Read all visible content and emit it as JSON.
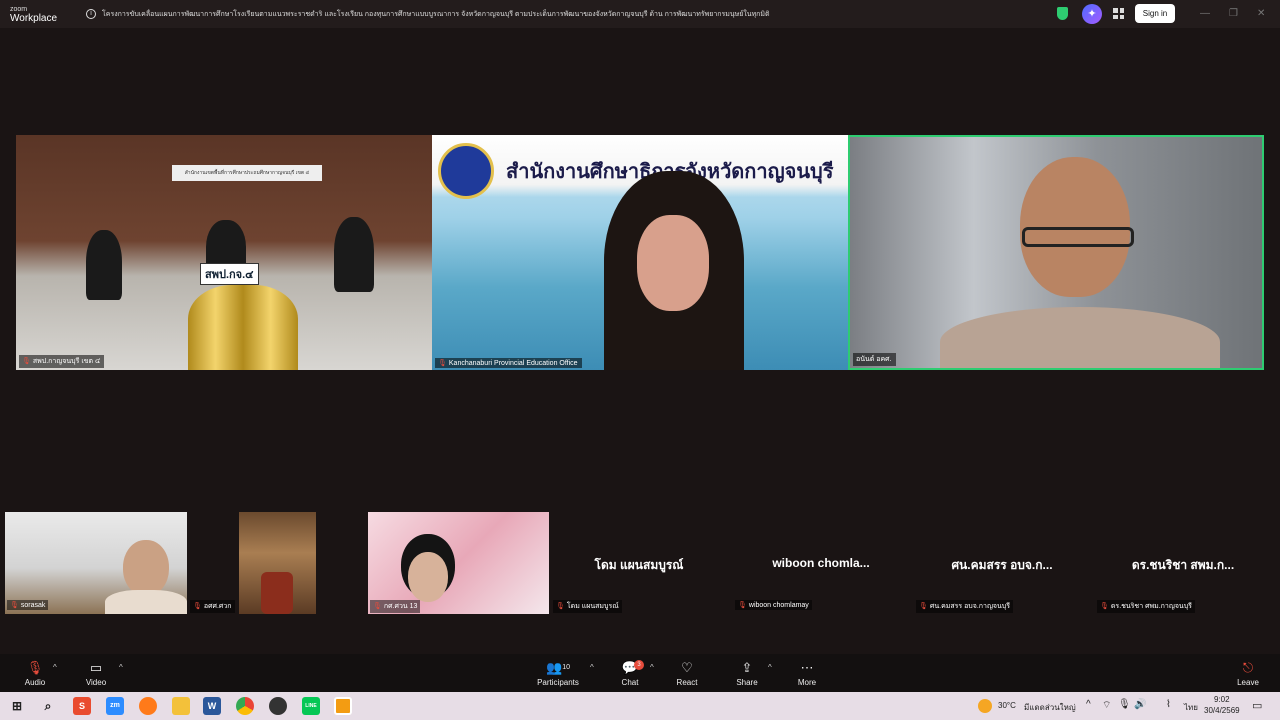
{
  "app": {
    "logo_top": "zoom",
    "logo_bottom": "Workplace"
  },
  "meeting_title": "โครงการขับเคลื่อนแผนการพัฒนาการศึกษาโรงเรียนตามแนวพระราชดำริ และโรงเรียน กองทุนการศึกษาแบบบูรณาการ จังหวัดกาญจนบุรี ตามประเด็นการพัฒนาของจังหวัดกาญจนบุรี ด้าน การพัฒนาทรัพยากรมนุษย์ในทุกมิติ",
  "topbar": {
    "signin_label": "Sign in"
  },
  "main_tiles": [
    {
      "name": "สพป.กาญจนบุรี เขต ๔",
      "room_sign": "สำนักงานเขตพื้นที่การศึกษาประถมศึกษากาญจนบุรี เขต ๔",
      "desk_label": "สพป.กจ.๔"
    },
    {
      "name": "Kanchanaburi Provincial Education Office",
      "banner_title": "สำนักงานศึกษาธิการจังหวัดกาญจนบุรี"
    },
    {
      "name": "อนันต์ อคศ."
    }
  ],
  "gallery": [
    {
      "name": "sorasak"
    },
    {
      "name": "อศศ.ศวก"
    },
    {
      "name": "กศ.ศวน 13"
    },
    {
      "name": "โดม แผนสมบูรณ์",
      "display_name": "โดม แผนสมบูรณ์"
    },
    {
      "name": "wiboon chomlamay",
      "display_name": "wiboon  chomla..."
    },
    {
      "name": "ศน.คมสรร อบจ.กาญจนบุรี",
      "display_name": "ศน.คมสรร อบจ.ก..."
    },
    {
      "name": "ดร.ชนริชา ศพม.กาญจนบุรี",
      "display_name": "ดร.ชนริชา สพม.ก..."
    }
  ],
  "toolbar": {
    "audio_label": "Audio",
    "video_label": "Video",
    "participants_label": "Participants",
    "participants_count": "10",
    "chat_label": "Chat",
    "chat_badge": "3",
    "react_label": "React",
    "share_label": "Share",
    "more_label": "More",
    "leave_label": "Leave"
  },
  "taskbar": {
    "weather": "30°C",
    "weather_desc": "มีแดดส่วนใหญ่",
    "lang": "ไทย",
    "time": "9:02",
    "date": "30/4/2569",
    "apps": [
      "S",
      "zm",
      "W",
      "LINE"
    ]
  },
  "colors": {
    "active_speaker_border": "#2ecc71",
    "muted_mic": "#e74c3c",
    "leave": "#e74c3c",
    "shield": "#2ecc71"
  }
}
